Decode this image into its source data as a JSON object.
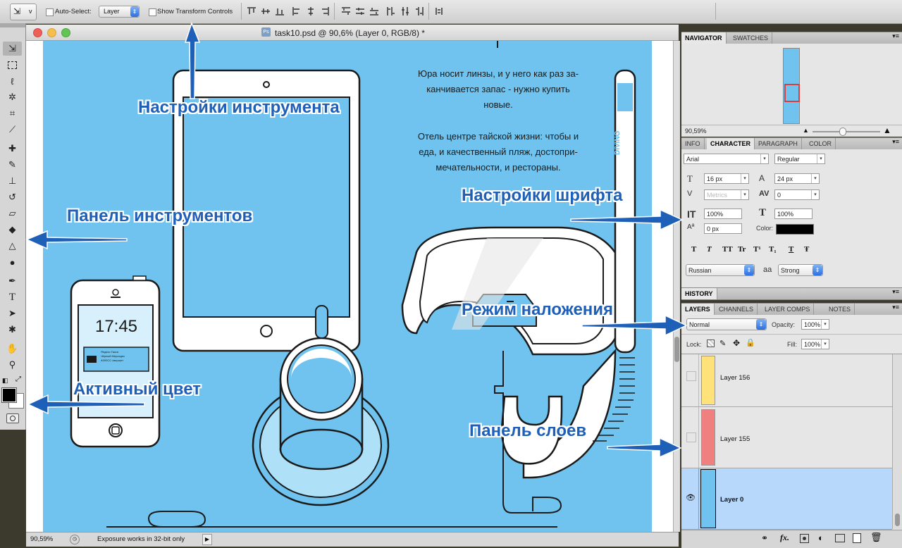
{
  "options_bar": {
    "tool_preset": "v",
    "auto_select_label": "Auto-Select:",
    "auto_select_value": "Layer",
    "show_transform_label": "Show Transform Controls"
  },
  "document": {
    "title": "task10.psd @ 90,6% (Layer 0, RGB/8) *",
    "status_zoom": "90,59%",
    "status_text": "Exposure works in 32-bit only"
  },
  "artwork": {
    "text_block_1": [
      "Юра носит линзы, и у него как раз за-",
      "канчивается запас - нужно купить",
      "новые."
    ],
    "text_block_2": [
      "Отель центре тайской жизни: чтобы и",
      "еда, и качественный пляж, достопри-",
      "мечательности, и рестораны."
    ],
    "phone_time": "17:45",
    "ticket_lines": [
      "Яндекс.Такси",
      "Чёрный Мерседес",
      "А000СС свершит"
    ],
    "snorkel_label": "DIVING"
  },
  "annotations": {
    "tool_settings": "Настройки инструмента",
    "tools_panel": "Панель инструментов",
    "active_color": "Активный цвет",
    "font_settings": "Настройки шрифта",
    "blend_mode": "Режим наложения",
    "layers_panel": "Панель слоев"
  },
  "navigator": {
    "tabs": [
      "NAVIGATOR",
      "SWATCHES"
    ],
    "zoom": "90,59%"
  },
  "character": {
    "tabs": [
      "INFO",
      "CHARACTER",
      "PARAGRAPH",
      "COLOR"
    ],
    "font_family": "Arial",
    "font_style": "Regular",
    "font_size": "16 px",
    "leading": "24 px",
    "kerning": "Metrics",
    "tracking": "0",
    "vertical_scale": "100%",
    "horizontal_scale": "100%",
    "baseline_shift": "0 px",
    "color_label": "Color:",
    "color_value": "#000000",
    "style_buttons": [
      "T",
      "T",
      "TT",
      "Tr",
      "T¹",
      "T₁",
      "T",
      "Ŧ"
    ],
    "language": "Russian",
    "aa_label": "aa",
    "antialias": "Strong"
  },
  "history": {
    "tab": "HISTORY"
  },
  "layers": {
    "tabs": [
      "LAYERS",
      "CHANNELS",
      "LAYER COMPS",
      "NOTES"
    ],
    "blend_mode": "Normal",
    "opacity_label": "Opacity:",
    "opacity": "100%",
    "lock_label": "Lock:",
    "fill_label": "Fill:",
    "fill": "100%",
    "items": [
      {
        "name": "Layer 156",
        "color": "#ffe27a",
        "visible": false,
        "selected": false
      },
      {
        "name": "Layer 155",
        "color": "#f08080",
        "visible": false,
        "selected": false
      },
      {
        "name": "Layer 0",
        "color": "#6fc3ee",
        "visible": true,
        "selected": true
      }
    ]
  },
  "colors": {
    "artboard_blue": "#6fc3ee",
    "annotation_blue": "#1e5fb8",
    "selected_layer": "#b8d8fb"
  }
}
